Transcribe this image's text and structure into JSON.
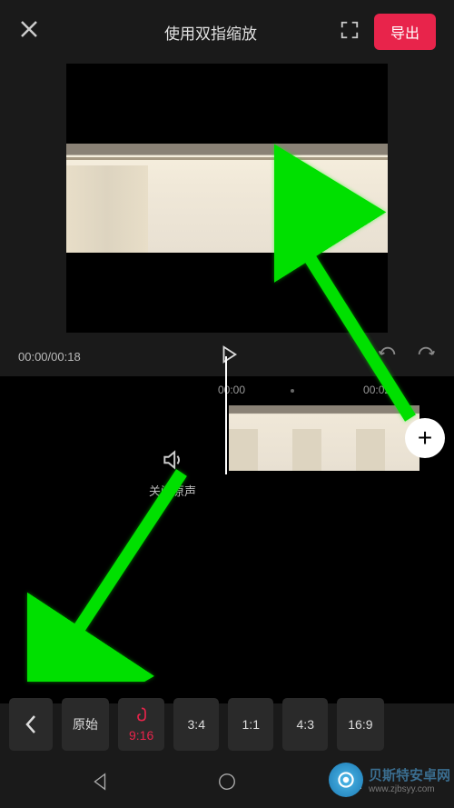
{
  "top": {
    "hint_text": "使用双指缩放",
    "export_label": "导出"
  },
  "controls": {
    "time_display": "00:00/00:18"
  },
  "timeline": {
    "ticks": [
      "00:00",
      "00:02"
    ],
    "sound_label": "关闭原声",
    "add_label": "+"
  },
  "ratio_bar": {
    "buttons": [
      {
        "label": "原始",
        "active": false
      },
      {
        "label": "9:16",
        "active": true
      },
      {
        "label": "3:4",
        "active": false
      },
      {
        "label": "1:1",
        "active": false
      },
      {
        "label": "4:3",
        "active": false
      },
      {
        "label": "16:9",
        "active": false
      }
    ]
  },
  "watermark": {
    "title": "贝斯特安卓网",
    "url": "www.zjbsyy.com"
  }
}
